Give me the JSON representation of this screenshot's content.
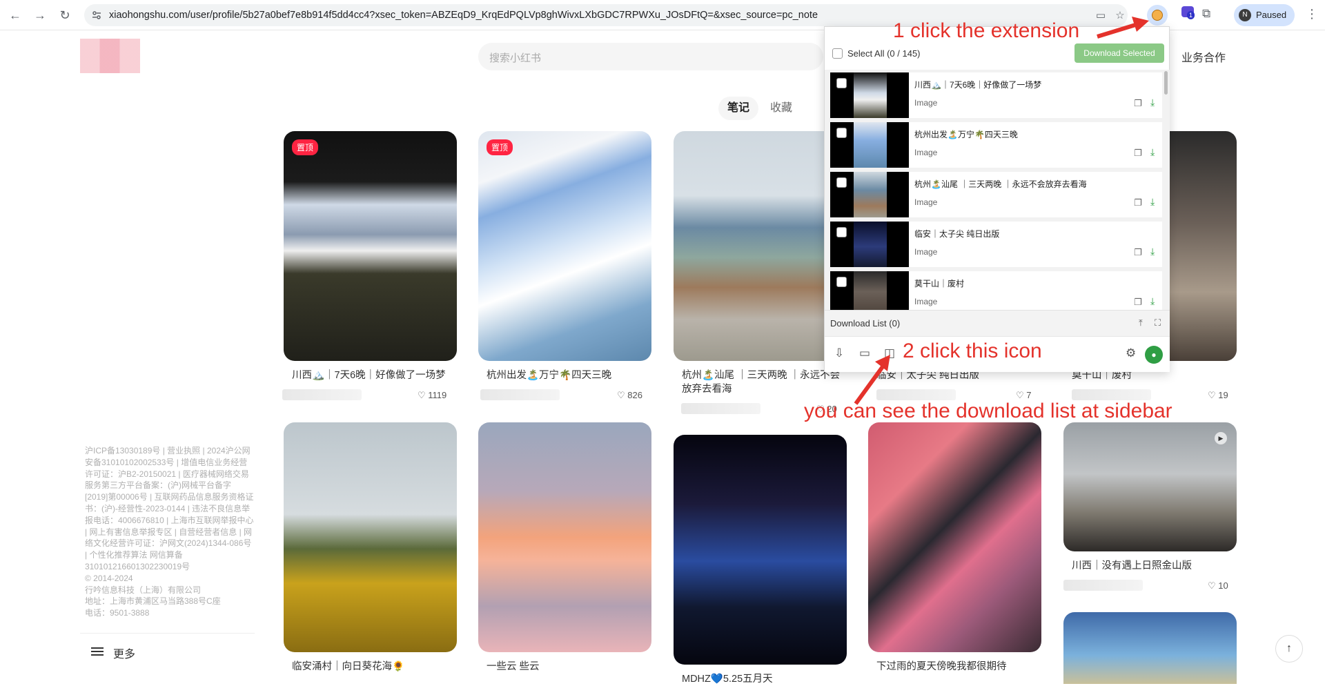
{
  "browser": {
    "url": "xiaohongshu.com/user/profile/5b27a0bef7e8b914f5dd4cc4?xsec_token=ABZEqD9_KrqEdPQLVp8ghWivxLXbGDC7RPWXu_JOsDFtQ=&xsec_source=pc_note",
    "profile_initial": "N",
    "profile_label": "Paused",
    "extension_badge": "1"
  },
  "header": {
    "search_placeholder": "搜索小红书",
    "business_link": "业务合作"
  },
  "tabs": [
    {
      "label": "笔记",
      "active": true
    },
    {
      "label": "收藏",
      "active": false
    }
  ],
  "pin_label": "置顶",
  "notes": [
    {
      "title": "川西🏔️｜7天6晚｜好像做了一场梦",
      "likes": "1119",
      "pinned": true
    },
    {
      "title": "杭州出发🏝️万宁🌴四天三晚",
      "likes": "826",
      "pinned": true
    },
    {
      "title": "杭州🏝️汕尾 ｜三天两晚 ｜永远不会放弃去看海",
      "likes": "20",
      "pinned": false
    },
    {
      "title": "临安｜太子尖 纯日出版",
      "likes": "7",
      "pinned": false
    },
    {
      "title": "莫干山｜废村",
      "likes": "19",
      "pinned": false
    },
    {
      "title": "临安涌村｜向日葵花海🌻",
      "likes": "",
      "pinned": false
    },
    {
      "title": "一些云 些云",
      "likes": "",
      "pinned": false
    },
    {
      "title": "MDHZ💙5.25五月天",
      "likes": "",
      "pinned": false
    },
    {
      "title": "下过雨的夏天傍晚我都很期待",
      "likes": "",
      "pinned": false
    },
    {
      "title": "川西｜没有遇上日照金山版",
      "likes": "10",
      "pinned": false
    }
  ],
  "footer": {
    "legal": "沪ICP备13030189号 | 营业执照 | 2024沪公网安备31010102002533号 | 增值电信业务经营许可证：沪B2-20150021 | 医疗器械网络交易服务第三方平台备案：(沪)网械平台备字[2019]第00006号 | 互联网药品信息服务资格证书：(沪)-经营性-2023-0144 | 违法不良信息举报电话：4006676810 | 上海市互联网举报中心 | 网上有害信息举报专区 | 自营经营者信息 | 网络文化经营许可证：沪网文(2024)1344-086号 | 个性化推荐算法 网信算备310101216601302230019号",
    "copyright": "© 2014-2024",
    "company": "行吟信息科技（上海）有限公司",
    "address": "地址：上海市黄浦区马当路388号C座",
    "phone": "电话：9501-3888",
    "more": "更多"
  },
  "popup": {
    "select_all": "Select All (0 / 145)",
    "download_selected": "Download Selected",
    "items": [
      {
        "title": "川西🏔️｜7天6晚｜好像做了一场梦",
        "type": "Image"
      },
      {
        "title": "杭州出发🏝️万宁🌴四天三晚",
        "type": "Image"
      },
      {
        "title": "杭州🏝️汕尾 ｜三天两晚 ｜永远不会放弃去看海",
        "type": "Image"
      },
      {
        "title": "临安｜太子尖 纯日出版",
        "type": "Image"
      },
      {
        "title": "莫干山｜废村",
        "type": "Image"
      }
    ],
    "download_list": "Download List (0)"
  },
  "annotations": {
    "step1": "1 click the extension",
    "step2": "2 click this icon",
    "step3": "you can see the download list at sidebar"
  },
  "colors": {
    "brand": "#ff2442",
    "annotation": "#e4322b",
    "download_green": "#8bc986"
  }
}
